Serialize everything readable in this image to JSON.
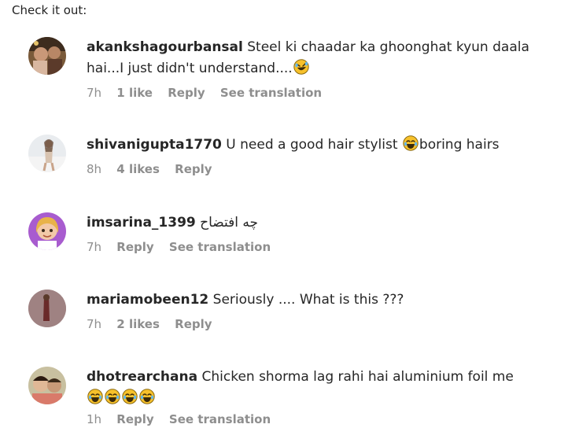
{
  "intro": "Check it out:",
  "comments": [
    {
      "username": "akankshagourbansal",
      "text": "Steel ki chaadar ka ghoonghat kyun daala hai...I just didn't understand....",
      "emoji_after": [
        "rolling-laughing-emoji"
      ],
      "time": "7h",
      "likes": "1 like",
      "reply": "Reply",
      "translation": "See translation"
    },
    {
      "username": "shivanigupta1770",
      "text_before": "U need a good hair stylist",
      "emoji_mid": [
        "joy-emoji"
      ],
      "text_after": "boring hairs",
      "time": "8h",
      "likes": "4 likes",
      "reply": "Reply"
    },
    {
      "username": "imsarina_1399",
      "text": "چه افتضاح",
      "time": "7h",
      "reply": "Reply",
      "translation": "See translation"
    },
    {
      "username": "mariamobeen12",
      "text": "Seriously .... What is this ???",
      "time": "7h",
      "likes": "2 likes",
      "reply": "Reply"
    },
    {
      "username": "dhotrearchana",
      "text": "Chicken shorma lag rahi hai aluminium foil me",
      "emoji_after": [
        "joy-emoji",
        "joy-emoji",
        "joy-emoji",
        "joy-emoji"
      ],
      "time": "1h",
      "reply": "Reply",
      "translation": "See translation"
    }
  ],
  "colors": {
    "text": "#262626",
    "meta": "#8e8e8e",
    "emoji_yellow": "#f7c12b"
  }
}
